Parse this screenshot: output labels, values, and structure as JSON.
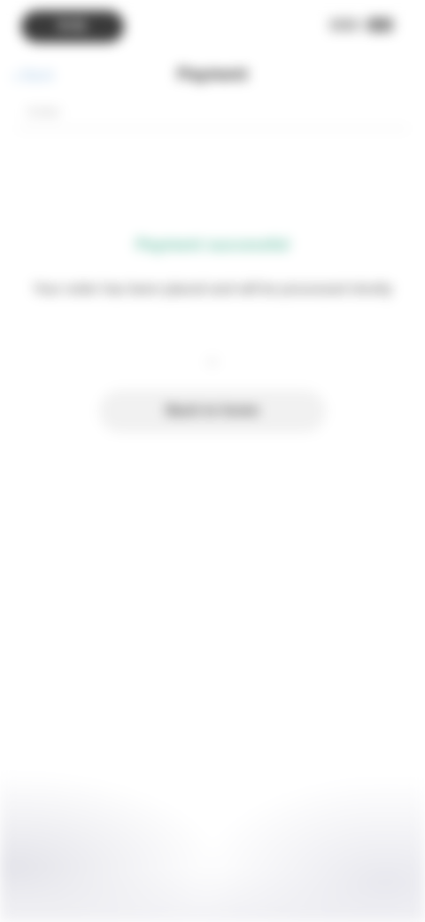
{
  "status_bar": {
    "time": "9:41"
  },
  "nav": {
    "back_label": "Back",
    "title": "Payment",
    "sub_label": "Order"
  },
  "main": {
    "success_text": "Payment successful",
    "message_text": "Your order has been placed and will be processed shortly",
    "separator_text": "or",
    "action_label": "Back to home"
  },
  "colors": {
    "accent_green": "#6ec1a8",
    "accent_blue": "#9fc4e6"
  },
  "icons": {
    "back": "chevron-left-icon",
    "signal": "signal-icon",
    "battery": "battery-icon"
  }
}
